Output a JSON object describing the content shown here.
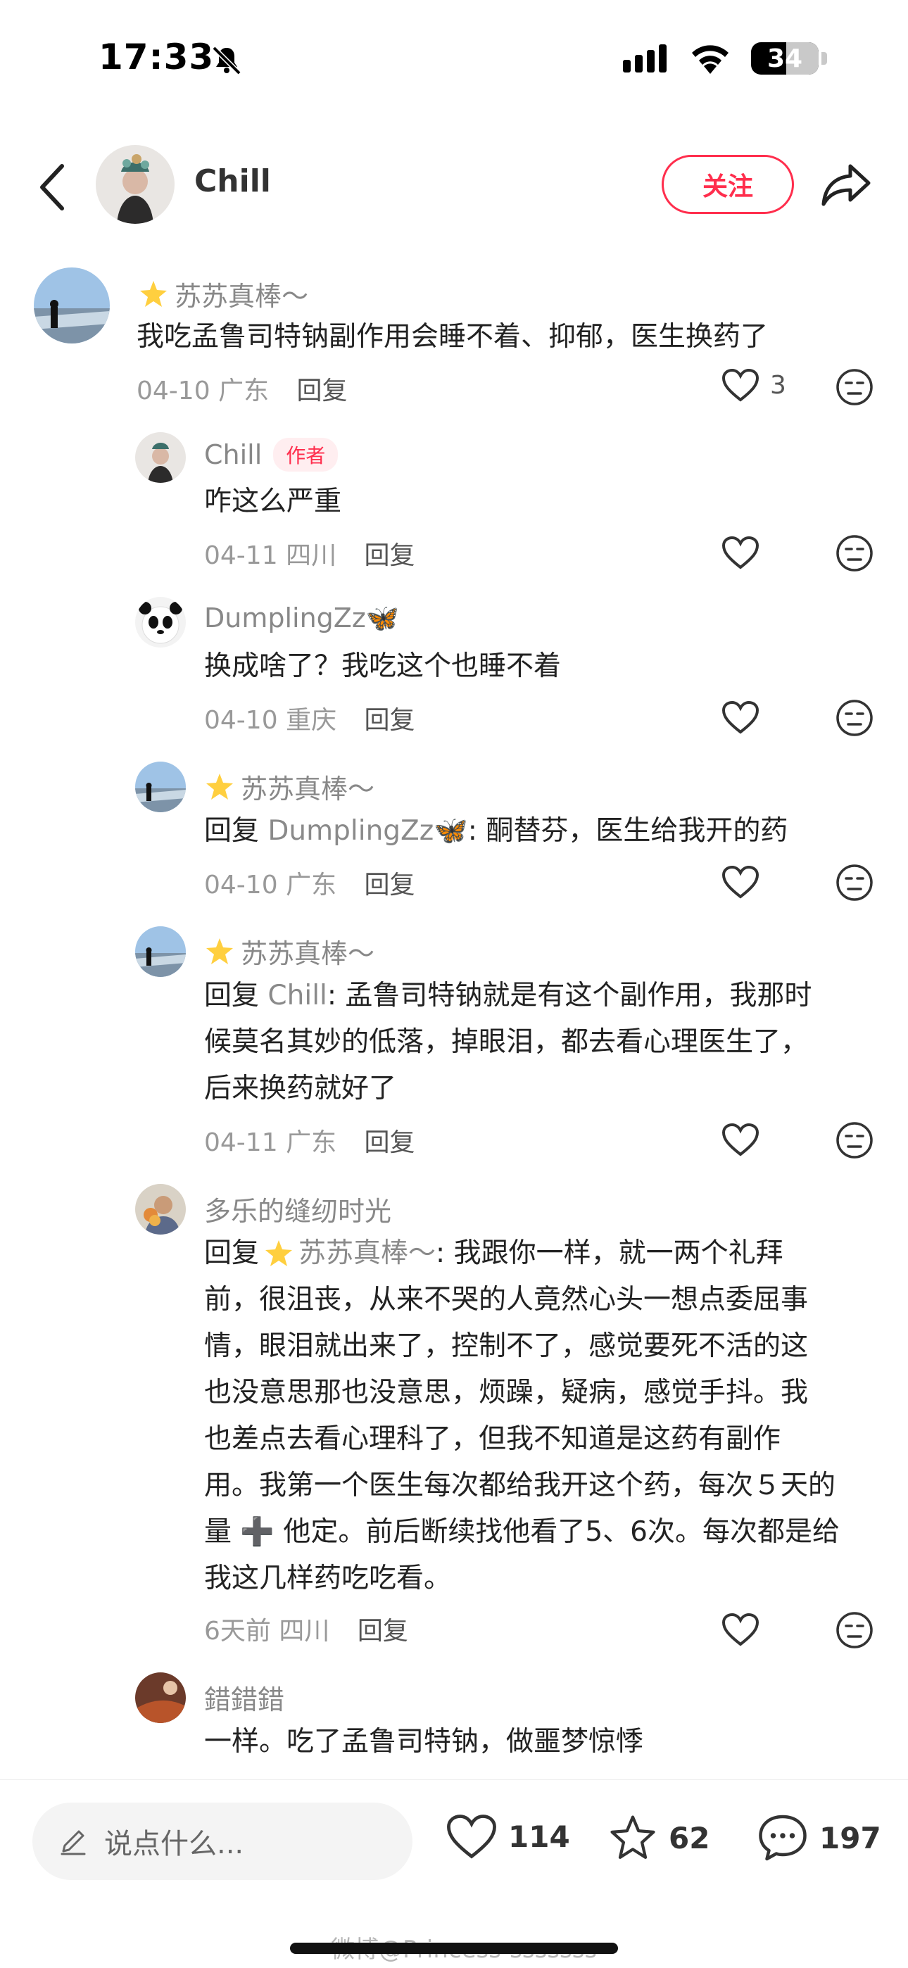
{
  "status_bar": {
    "time": "17:33",
    "battery": "34"
  },
  "header": {
    "author_name": "Chill",
    "follow_label": "关注"
  },
  "comments": [
    {
      "name": "苏苏真棒～",
      "text": "我吃孟鲁司特钠副作用会睡不着、抑郁，医生换药了",
      "date": "04-10",
      "location": "广东",
      "reply_label": "回复",
      "likes": "3"
    },
    {
      "name": "Chill",
      "author_tag": "作者",
      "text": "咋这么严重",
      "date": "04-11",
      "location": "四川",
      "reply_label": "回复"
    },
    {
      "name": "DumplingZz🦋",
      "text": "换成啥了？我吃这个也睡不着",
      "date": "04-10",
      "location": "重庆",
      "reply_label": "回复"
    },
    {
      "name": "苏苏真棒～",
      "reply_prefix": "回复 ",
      "reply_to": "DumplingZz🦋",
      "text": ": 酮替芬，医生给我开的药",
      "date": "04-10",
      "location": "广东",
      "reply_label": "回复"
    },
    {
      "name": "苏苏真棒～",
      "reply_prefix": "回复 ",
      "reply_to": "Chill",
      "text_lines": [
        ": 孟鲁司特钠就是有这个副作用，我那时",
        "候莫名其妙的低落，掉眼泪，都去看心理医生了，",
        "后来换药就好了"
      ],
      "date": "04-11",
      "location": "广东",
      "reply_label": "回复"
    },
    {
      "name": "多乐的缝纫时光",
      "reply_prefix": "回复 ",
      "reply_to": "苏苏真棒～",
      "text_lines": [
        ": 我跟你一样，就一两个礼拜",
        "前，很沮丧，从来不哭的人竟然心头一想点委屈事",
        "情，眼泪就出来了，控制不了，感觉要死不活的这",
        "也没意思那也没意思，烦躁，疑病，感觉手抖。我",
        "也差点去看心理科了，但我不知道是这药有副作",
        "用。我第一个医生每次都给我开这个药，每次５天的",
        "量 ➕ 他定。前后断续找他看了5、6次。每次都是给",
        "我这几样药吃吃看。"
      ],
      "date": "6天前",
      "location": "四川",
      "reply_label": "回复"
    },
    {
      "name": "錯錯錯",
      "text": "一样。吃了孟鲁司特钠，做噩梦惊悸"
    }
  ],
  "bottom_bar": {
    "input_placeholder": "说点什么...",
    "likes": "114",
    "favorites": "62",
    "comments": "197"
  },
  "watermark": "微博@Princess-sssssss"
}
